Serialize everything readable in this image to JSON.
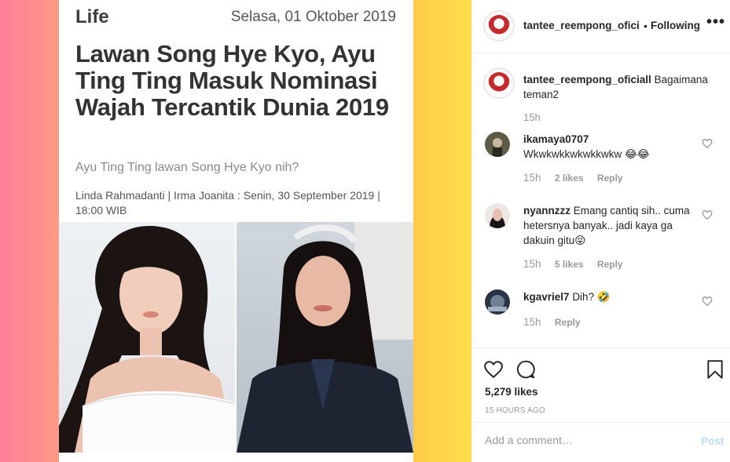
{
  "post": {
    "article": {
      "category": "Life",
      "date": "Selasa, 01 Oktober 2019",
      "headline": "Lawan Song Hye Kyo, Ayu Ting Ting Masuk Nominasi Wajah Tercantik Dunia 2019",
      "subheadline": "Ayu Ting Ting lawan Song Hye Kyo nih?",
      "byline": "Linda Rahmadanti | Irma Joanita : Senin, 30 September 2019 | 18:00 WIB"
    }
  },
  "header": {
    "username": "tantee_reempong_ofici",
    "separator": "•",
    "follow_status": "Following",
    "more_label": "•••"
  },
  "caption": {
    "username": "tantee_reempong_oficiall",
    "text": "Bagaimana teman2",
    "time": "15h"
  },
  "comments": [
    {
      "username": "ikamaya0707",
      "text": "Wkwkwkkwkwkkwkw 😂😂",
      "time": "15h",
      "likes": "2 likes",
      "reply": "Reply"
    },
    {
      "username": "nyannzzz",
      "text": "Emang cantiq sih.. cuma hetersnya banyak.. jadi kaya ga dakuin gitu😝",
      "time": "15h",
      "likes": "5 likes",
      "reply": "Reply"
    },
    {
      "username": "kgavriel7",
      "text": "Dih? 🤣",
      "time": "15h",
      "likes": "",
      "reply": "Reply"
    }
  ],
  "actions": {
    "likes": "5,279 likes",
    "posted": "15 HOURS AGO"
  },
  "add_comment": {
    "placeholder": "Add a comment…",
    "post_label": "Post"
  }
}
